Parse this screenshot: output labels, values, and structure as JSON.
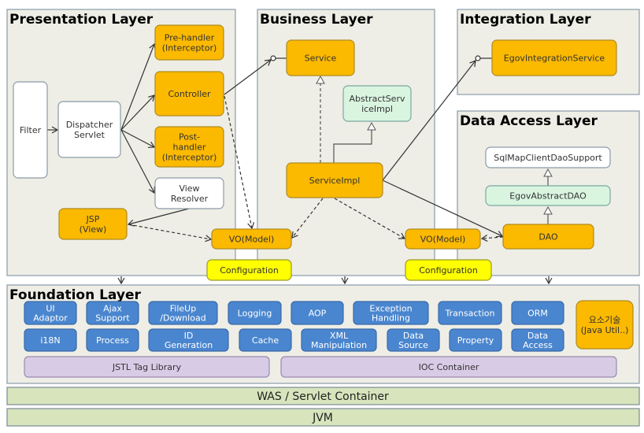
{
  "layers": {
    "presentation": "Presentation Layer",
    "business": "Business Layer",
    "integration": "Integration Layer",
    "data_access": "Data Access Layer",
    "foundation": "Foundation Layer",
    "was": "WAS / Servlet Container",
    "jvm": "JVM"
  },
  "components": {
    "filter": [
      "Filter"
    ],
    "dispatcher": [
      "Dispatcher",
      "Servlet"
    ],
    "prehandler": [
      "Pre-handler",
      "(Interceptor)"
    ],
    "controller": [
      "Controller"
    ],
    "posthandler": [
      "Post-",
      "handler",
      "(Interceptor)"
    ],
    "viewresolver": [
      "View",
      "Resolver"
    ],
    "jsp": [
      "JSP",
      "(View)"
    ],
    "vo1": [
      "VO(Model)"
    ],
    "config1": [
      "Configuration"
    ],
    "service": [
      "Service"
    ],
    "abstractservice": [
      "AbstractServ",
      "iceImpl"
    ],
    "serviceimpl": [
      "ServiceImpl"
    ],
    "vo2": [
      "VO(Model)"
    ],
    "config2": [
      "Configuration"
    ],
    "integration": [
      "EgovIntegrationService"
    ],
    "sqlmap": [
      "SqlMapClientDaoSupport"
    ],
    "egovdao": [
      "EgovAbstractDAO"
    ],
    "dao": [
      "DAO"
    ]
  },
  "foundation": {
    "row1": [
      [
        "UI",
        "Adaptor"
      ],
      [
        "Ajax",
        "Support"
      ],
      [
        "FileUp",
        "/Download"
      ],
      [
        "Logging"
      ],
      [
        "AOP"
      ],
      [
        "Exception",
        "Handling"
      ],
      [
        "Transaction"
      ],
      [
        "ORM"
      ]
    ],
    "row2": [
      [
        "i18N"
      ],
      [
        "Process"
      ],
      [
        "ID",
        "Generation"
      ],
      [
        "Cache"
      ],
      [
        "XML",
        "Manipulation"
      ],
      [
        "Data",
        "Source"
      ],
      [
        "Property"
      ],
      [
        "Data",
        "Access"
      ]
    ],
    "util": [
      "요소기술",
      "(Java Util..)"
    ],
    "jstl": "JSTL Tag Library",
    "ioc": "IOC Container"
  },
  "colors": {
    "panel": "#eeeee6",
    "orange": "#fbb900",
    "yellow": "#ffff00",
    "green_box": "#d9f5e0",
    "blue": "#4a86cf",
    "purple": "#d8cbe6",
    "container": "#d8e4bc"
  }
}
